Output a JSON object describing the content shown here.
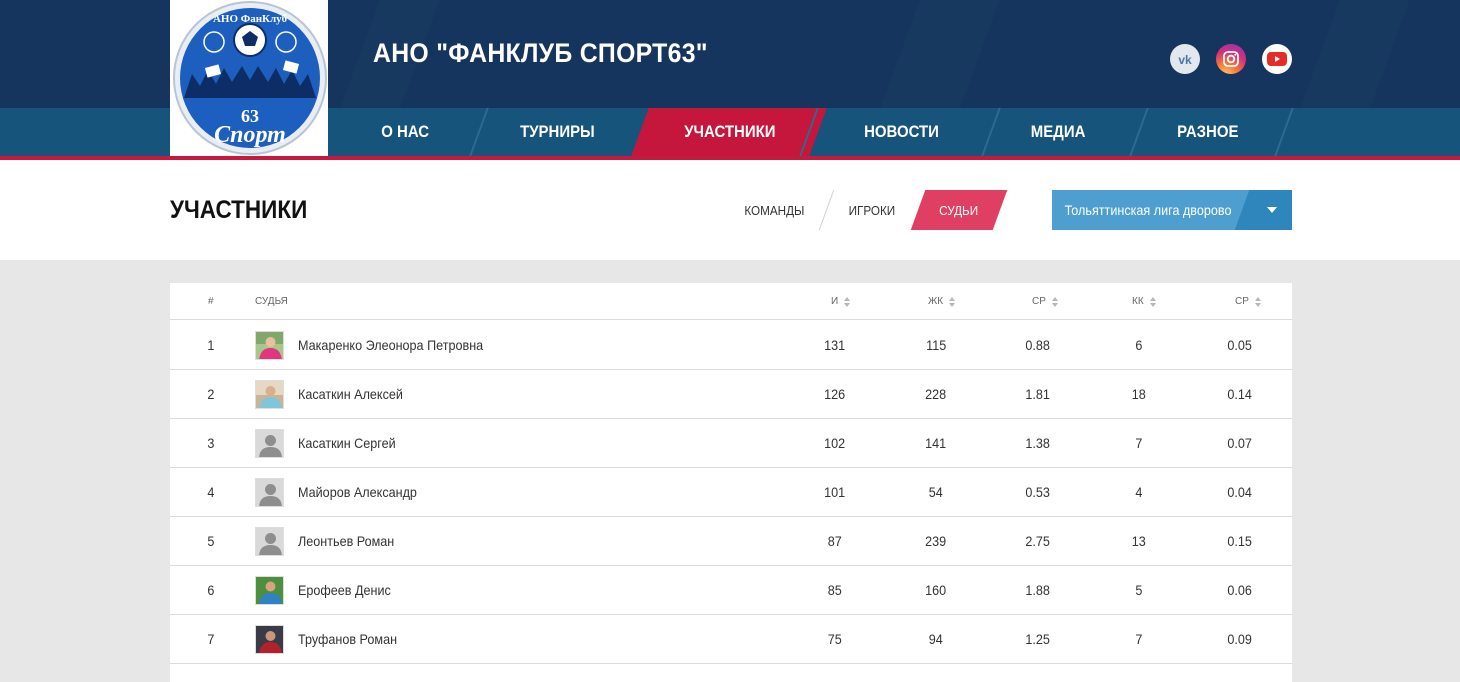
{
  "site": {
    "title": "АНО \"ФАНКЛУБ СПОРТ63\"",
    "logo_text_top": "АНО ФанКлуб",
    "logo_text_bottom": "Спорт",
    "logo_number": "63"
  },
  "social": [
    {
      "name": "vk",
      "icon": "vk-icon"
    },
    {
      "name": "instagram",
      "icon": "instagram-icon"
    },
    {
      "name": "youtube",
      "icon": "youtube-icon"
    }
  ],
  "nav": {
    "items": [
      {
        "label": "О НАС",
        "active": false
      },
      {
        "label": "ТУРНИРЫ",
        "active": false
      },
      {
        "label": "УЧАСТНИКИ",
        "active": true
      },
      {
        "label": "НОВОСТИ",
        "active": false
      },
      {
        "label": "МЕДИА",
        "active": false
      },
      {
        "label": "РАЗНОЕ",
        "active": false
      }
    ]
  },
  "page": {
    "title": "УЧАСТНИКИ",
    "subtabs": [
      {
        "label": "КОМАНДЫ",
        "active": false
      },
      {
        "label": "ИГРОКИ",
        "active": false
      },
      {
        "label": "СУДЬИ",
        "active": true
      }
    ],
    "league_select": "Тольяттинская лига дворово..."
  },
  "colors": {
    "header_dark": "#15345e",
    "nav_blue": "#16547c",
    "accent_red": "#c5163c",
    "subtab_active": "#df3f63",
    "select_blue": "#4e9fd0"
  },
  "table": {
    "columns": [
      {
        "label": "#",
        "sortable": false
      },
      {
        "label": "СУДЬЯ",
        "sortable": false
      },
      {
        "label": "И",
        "sortable": true
      },
      {
        "label": "ЖК",
        "sortable": true
      },
      {
        "label": "СР",
        "sortable": true
      },
      {
        "label": "КК",
        "sortable": true
      },
      {
        "label": "СР",
        "sortable": true
      }
    ],
    "rows": [
      {
        "n": "1",
        "name": "Макаренко Элеонора Петровна",
        "games": "131",
        "yc": "115",
        "yc_avg": "0.88",
        "rc": "6",
        "rc_avg": "0.05",
        "avatar": "photo-pink"
      },
      {
        "n": "2",
        "name": "Касаткин Алексей",
        "games": "126",
        "yc": "228",
        "yc_avg": "1.81",
        "rc": "18",
        "rc_avg": "0.14",
        "avatar": "photo-light"
      },
      {
        "n": "3",
        "name": "Касаткин Сергей",
        "games": "102",
        "yc": "141",
        "yc_avg": "1.38",
        "rc": "7",
        "rc_avg": "0.07",
        "avatar": "placeholder"
      },
      {
        "n": "4",
        "name": "Майоров Александр",
        "games": "101",
        "yc": "54",
        "yc_avg": "0.53",
        "rc": "4",
        "rc_avg": "0.04",
        "avatar": "placeholder"
      },
      {
        "n": "5",
        "name": "Леонтьев Роман",
        "games": "87",
        "yc": "239",
        "yc_avg": "2.75",
        "rc": "13",
        "rc_avg": "0.15",
        "avatar": "placeholder"
      },
      {
        "n": "6",
        "name": "Ерофеев Денис",
        "games": "85",
        "yc": "160",
        "yc_avg": "1.88",
        "rc": "5",
        "rc_avg": "0.06",
        "avatar": "photo-green"
      },
      {
        "n": "7",
        "name": "Труфанов Роман",
        "games": "75",
        "yc": "94",
        "yc_avg": "1.25",
        "rc": "7",
        "rc_avg": "0.09",
        "avatar": "photo-dark"
      }
    ]
  }
}
